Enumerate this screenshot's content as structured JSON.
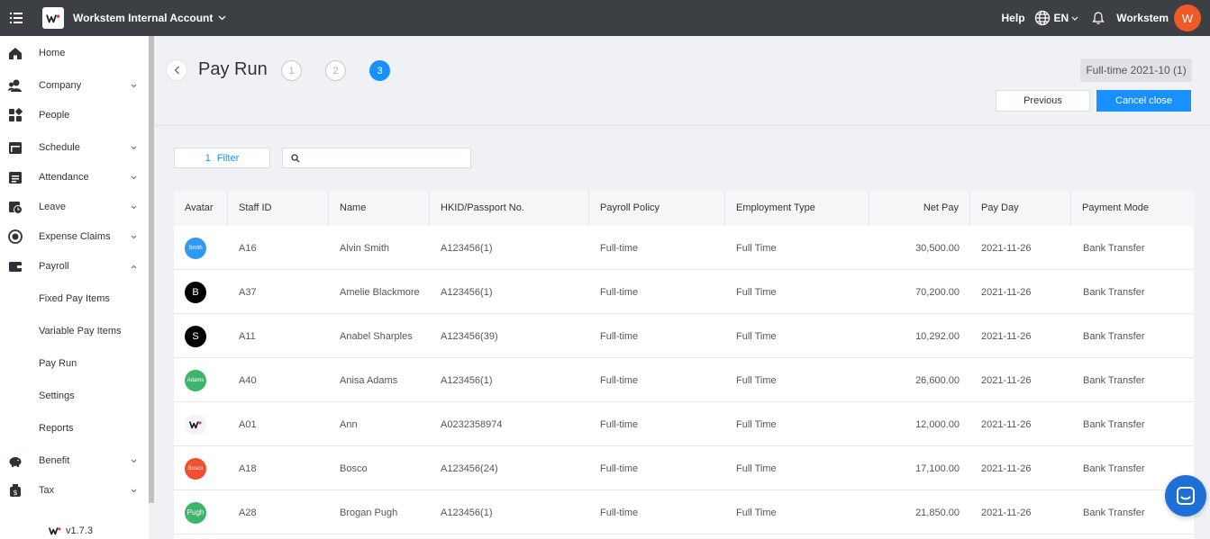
{
  "topbar": {
    "account_name": "Workstem Internal Account",
    "help": "Help",
    "language": "EN",
    "username": "Workstem",
    "user_initial": "W",
    "avatar_color": "#f05a28"
  },
  "sidebar": {
    "items": [
      {
        "label": "Home"
      },
      {
        "label": "Company"
      },
      {
        "label": "People"
      },
      {
        "label": "Schedule"
      },
      {
        "label": "Attendance"
      },
      {
        "label": "Leave"
      },
      {
        "label": "Expense Claims"
      },
      {
        "label": "Payroll"
      },
      {
        "label": "Fixed Pay Items"
      },
      {
        "label": "Variable Pay Items"
      },
      {
        "label": "Pay Run"
      },
      {
        "label": "Settings"
      },
      {
        "label": "Reports"
      },
      {
        "label": "Benefit"
      },
      {
        "label": "Tax"
      }
    ],
    "version": "v1.7.3"
  },
  "header": {
    "title": "Pay Run",
    "steps": [
      "1",
      "2",
      "3"
    ],
    "active_step": "3",
    "period": "Full-time 2021-10 (1)",
    "previous_label": "Previous",
    "cancel_close_label": "Cancel close"
  },
  "filter": {
    "count": "1",
    "label": "Filter",
    "search_placeholder": ""
  },
  "table": {
    "columns": [
      "Avatar",
      "Staff ID",
      "Name",
      "HKID/Passport No.",
      "Payroll Policy",
      "Employment Type",
      "Net Pay",
      "Pay Day",
      "Payment Mode"
    ],
    "rows": [
      {
        "avatar_text": "Smith",
        "avatar_color": "#2e9bf0",
        "staff_id": "A16",
        "name": "Alvin Smith",
        "hkid": "A123456(1)",
        "policy": "Full-time",
        "employment": "Full Time",
        "net_pay": "30,500.00",
        "pay_day": "2021-11-26",
        "mode": "Bank Transfer"
      },
      {
        "avatar_text": "B",
        "avatar_color": "#000000",
        "staff_id": "A37",
        "name": "Amelie Blackmore",
        "hkid": "A123456(1)",
        "policy": "Full-time",
        "employment": "Full Time",
        "net_pay": "70,200.00",
        "pay_day": "2021-11-26",
        "mode": "Bank Transfer"
      },
      {
        "avatar_text": "S",
        "avatar_color": "#000000",
        "staff_id": "A11",
        "name": "Anabel Sharples",
        "hkid": "A123456(39)",
        "policy": "Full-time",
        "employment": "Full Time",
        "net_pay": "10,292.00",
        "pay_day": "2021-11-26",
        "mode": "Bank Transfer"
      },
      {
        "avatar_text": "Adams",
        "avatar_color": "#3fb56b",
        "staff_id": "A40",
        "name": "Anisa Adams",
        "hkid": "A123456(1)",
        "policy": "Full-time",
        "employment": "Full Time",
        "net_pay": "26,600.00",
        "pay_day": "2021-11-26",
        "mode": "Bank Transfer"
      },
      {
        "avatar_text": "",
        "avatar_color": "#f4f4f6",
        "staff_id": "A01",
        "name": "Ann",
        "hkid": "A0232358974",
        "policy": "Full-time",
        "employment": "Full Time",
        "net_pay": "12,000.00",
        "pay_day": "2021-11-26",
        "mode": "Bank Transfer"
      },
      {
        "avatar_text": "Bosco",
        "avatar_color": "#f0502e",
        "staff_id": "A18",
        "name": "Bosco",
        "hkid": "A123456(24)",
        "policy": "Full-time",
        "employment": "Full Time",
        "net_pay": "17,100.00",
        "pay_day": "2021-11-26",
        "mode": "Bank Transfer"
      },
      {
        "avatar_text": "Pugh",
        "avatar_color": "#3fb56b",
        "staff_id": "A28",
        "name": "Brogan Pugh",
        "hkid": "A123456(1)",
        "policy": "Full-time",
        "employment": "Full Time",
        "net_pay": "21,850.00",
        "pay_day": "2021-11-26",
        "mode": "Bank Transfer"
      }
    ]
  },
  "colors": {
    "primary": "#1890ff",
    "topbar": "#3c3f44"
  }
}
